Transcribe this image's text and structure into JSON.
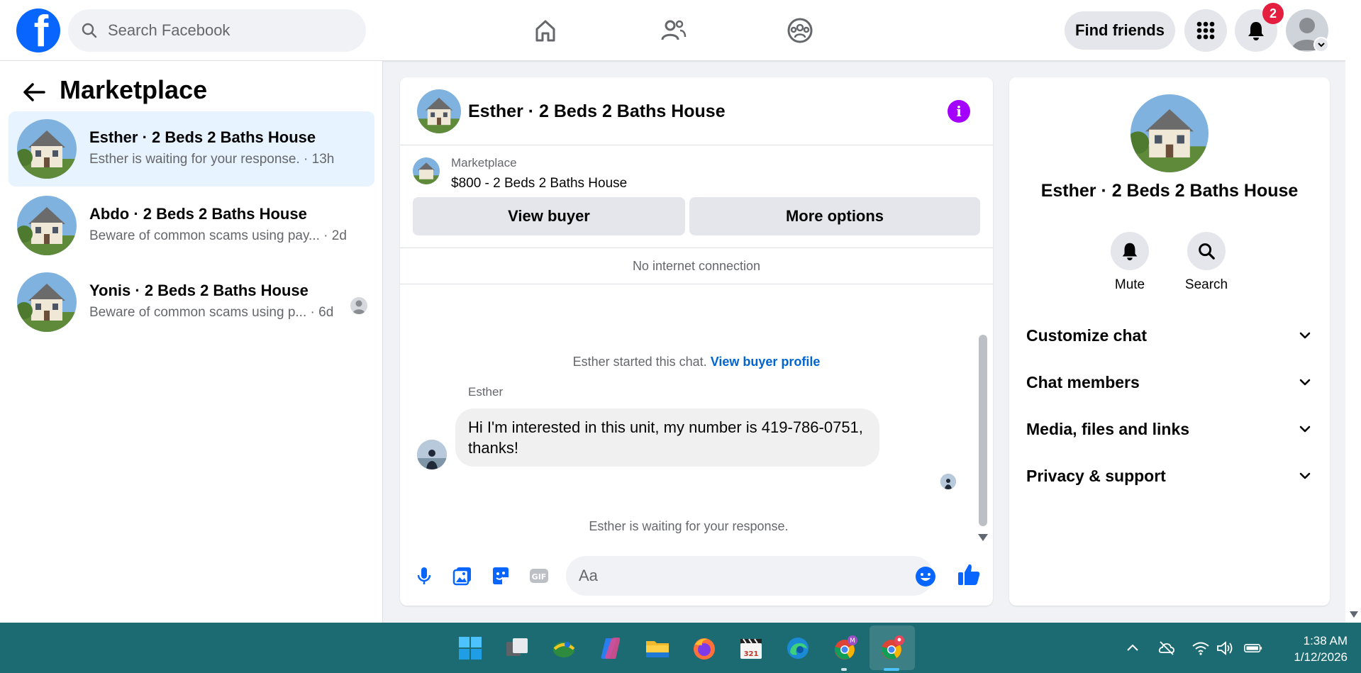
{
  "header": {
    "logo_letter": "f",
    "search_placeholder": "Search Facebook",
    "nav_icons": [
      "home-icon",
      "friends-icon",
      "groups-icon"
    ],
    "find_friends_label": "Find friends",
    "notification_count": "2",
    "brand_color": "#0866ff"
  },
  "sidebar": {
    "title": "Marketplace",
    "conversations": [
      {
        "name": "Esther · 2 Beds 2 Baths House",
        "snippet": "Esther is waiting for your response. · 13h",
        "active": true
      },
      {
        "name": "Abdo · 2 Beds 2 Baths House",
        "snippet": "Beware of common scams using pay...  · 2d",
        "active": false
      },
      {
        "name": "Yonis · 2 Beds 2 Baths House",
        "snippet": "Beware of common scams using p... · 6d",
        "active": false
      }
    ]
  },
  "chat": {
    "title": "Esther · 2 Beds 2 Baths House",
    "listing_source": "Marketplace",
    "listing_price": "$800 - 2 Beds 2 Baths House",
    "view_buyer_label": "View buyer",
    "more_options_label": "More options",
    "connection_status": "No internet connection",
    "started_text": "Esther started this chat.",
    "view_buyer_profile_label": "View buyer profile",
    "sender_name": "Esther",
    "message_text": "Hi I'm interested in this unit, my number is 419-786-0751, thanks!",
    "waiting_text": "Esther is waiting for your response.",
    "input_placeholder": "Aa",
    "accent_color": "#0866ff",
    "info_color": "#a400ff"
  },
  "details": {
    "title": "Esther · 2 Beds 2 Baths House",
    "actions": [
      {
        "label": "Mute",
        "icon": "bell-icon"
      },
      {
        "label": "Search",
        "icon": "search-icon"
      }
    ],
    "sections": [
      "Customize chat",
      "Chat members",
      "Media, files and links",
      "Privacy & support"
    ]
  },
  "taskbar": {
    "apps": [
      "windows-start",
      "task-view",
      "globe-app",
      "copilot",
      "file-explorer",
      "firefox",
      "clapper",
      "edge",
      "chrome-profile-m",
      "chrome-active"
    ],
    "time": "1:38 AM",
    "date": "1/12/2026",
    "color": "#1d6b72"
  }
}
